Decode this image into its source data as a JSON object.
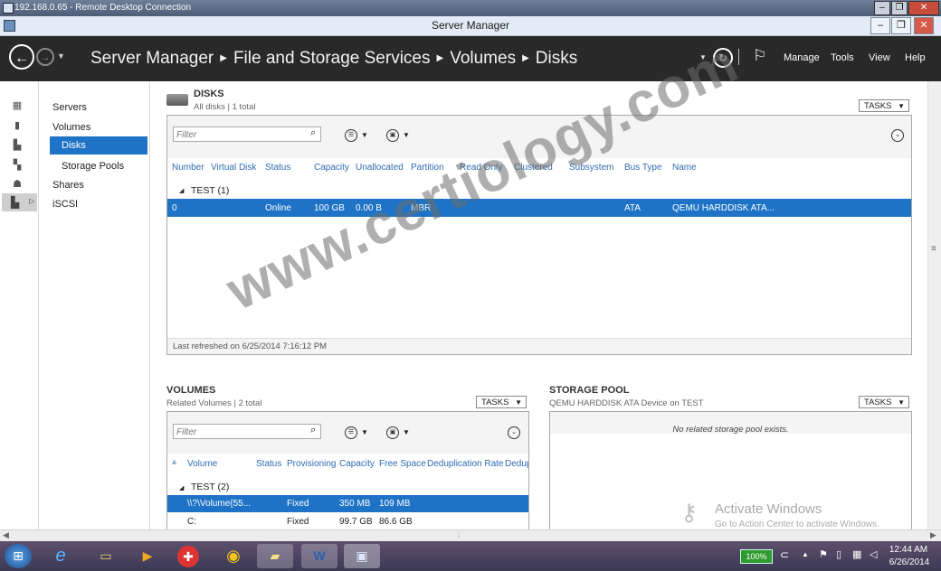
{
  "rdp": {
    "title": "192.168.0.65 - Remote Desktop Connection"
  },
  "window": {
    "title": "Server Manager"
  },
  "header": {
    "breadcrumb": [
      "Server Manager",
      "File and Storage Services",
      "Volumes",
      "Disks"
    ],
    "menu": {
      "manage": "Manage",
      "tools": "Tools",
      "view": "View",
      "help": "Help"
    }
  },
  "nav": {
    "servers": "Servers",
    "volumes": "Volumes",
    "disks": "Disks",
    "storage_pools": "Storage Pools",
    "shares": "Shares",
    "iscsi": "iSCSI"
  },
  "disks": {
    "title": "DISKS",
    "subtitle": "All disks | 1 total",
    "tasks": "TASKS",
    "filter_placeholder": "Filter",
    "columns": [
      "Number",
      "Virtual Disk",
      "Status",
      "Capacity",
      "Unallocated",
      "Partition",
      "Read Only",
      "Clustered",
      "Subsystem",
      "Bus Type",
      "Name"
    ],
    "group": "TEST (1)",
    "row": {
      "number": "0",
      "status": "Online",
      "capacity": "100 GB",
      "unallocated": "0.00 B",
      "partition": "MBR",
      "bus_type": "ATA",
      "name": "QEMU HARDDISK ATA..."
    },
    "refreshed": "Last refreshed on 6/25/2014 7:16:12 PM"
  },
  "volumes": {
    "title": "VOLUMES",
    "subtitle": "Related Volumes | 2 total",
    "tasks": "TASKS",
    "filter_placeholder": "Filter",
    "columns": [
      "Volume",
      "Status",
      "Provisioning",
      "Capacity",
      "Free Space",
      "Deduplication Rate",
      "Dedup"
    ],
    "group": "TEST (2)",
    "rows": [
      {
        "volume": "\\\\?\\Volume{55...",
        "provisioning": "Fixed",
        "capacity": "350 MB",
        "free": "109 MB"
      },
      {
        "volume": "C:",
        "provisioning": "Fixed",
        "capacity": "99.7 GB",
        "free": "86.6 GB"
      }
    ]
  },
  "storage_pool": {
    "title": "STORAGE POOL",
    "subtitle": "QEMU HARDDISK ATA Device on TEST",
    "tasks": "TASKS",
    "empty": "No related storage pool exists."
  },
  "activation": {
    "title": "Activate Windows",
    "sub": "Go to Action Center to activate Windows."
  },
  "watermark": "www.certiology.com",
  "taskbar": {
    "battery": "100%",
    "time": "12:44 AM",
    "date": "6/26/2014"
  }
}
